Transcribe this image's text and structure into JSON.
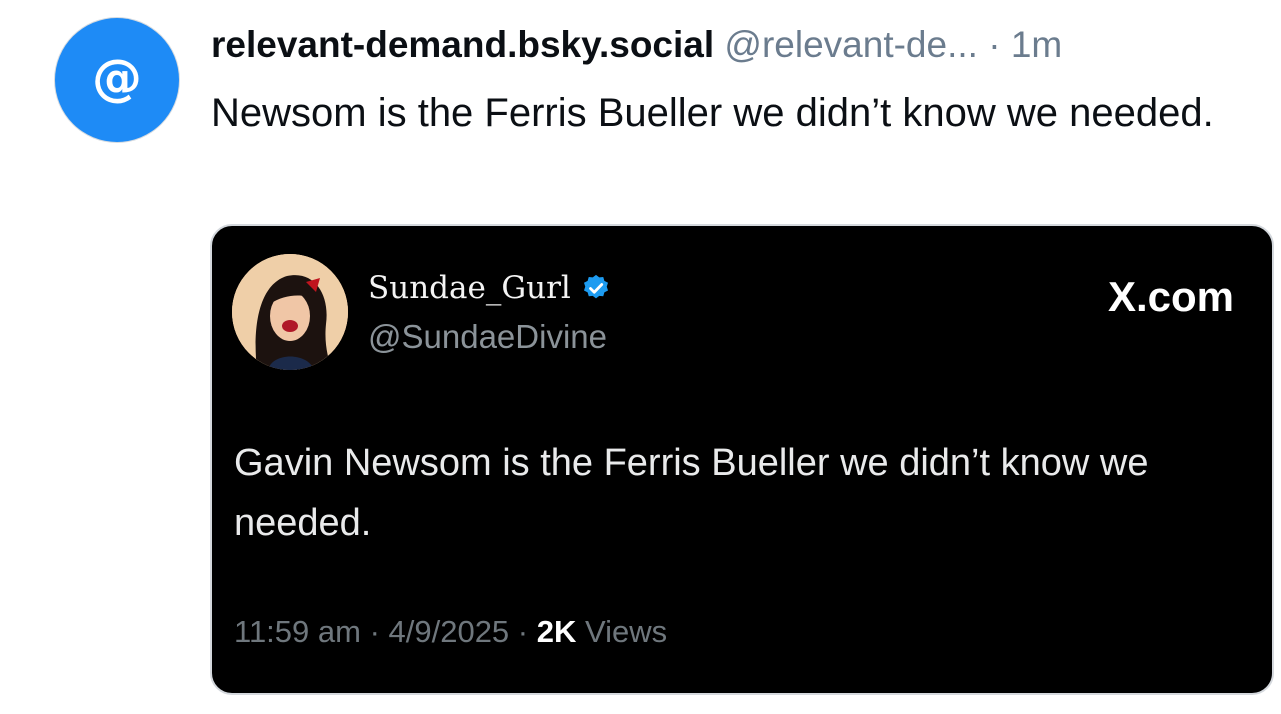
{
  "post": {
    "avatar_icon": "at-sign-icon",
    "avatar_glyph": "@",
    "display_name": "relevant-demand.bsky.social",
    "handle": "@relevant-de...",
    "separator": "·",
    "time": "1m",
    "text": "Newsom is the Ferris Bueller we didn’t know we needed."
  },
  "embed": {
    "name": "Sundae_Gurl",
    "verified_icon": "verified-badge-icon",
    "handle": "@SundaeDivine",
    "brand": "X.com",
    "text": "Gavin Newsom is the Ferris Bueller we didn’t know we needed.",
    "timestamp": "11:59 am · 4/9/2025 ·",
    "views_count": "2K",
    "views_label": "Views"
  },
  "colors": {
    "avatar_bg": "#1e8bf6",
    "muted_text": "#6b7c8e",
    "verified_blue": "#1d9bf0",
    "embed_bg": "#000000"
  }
}
